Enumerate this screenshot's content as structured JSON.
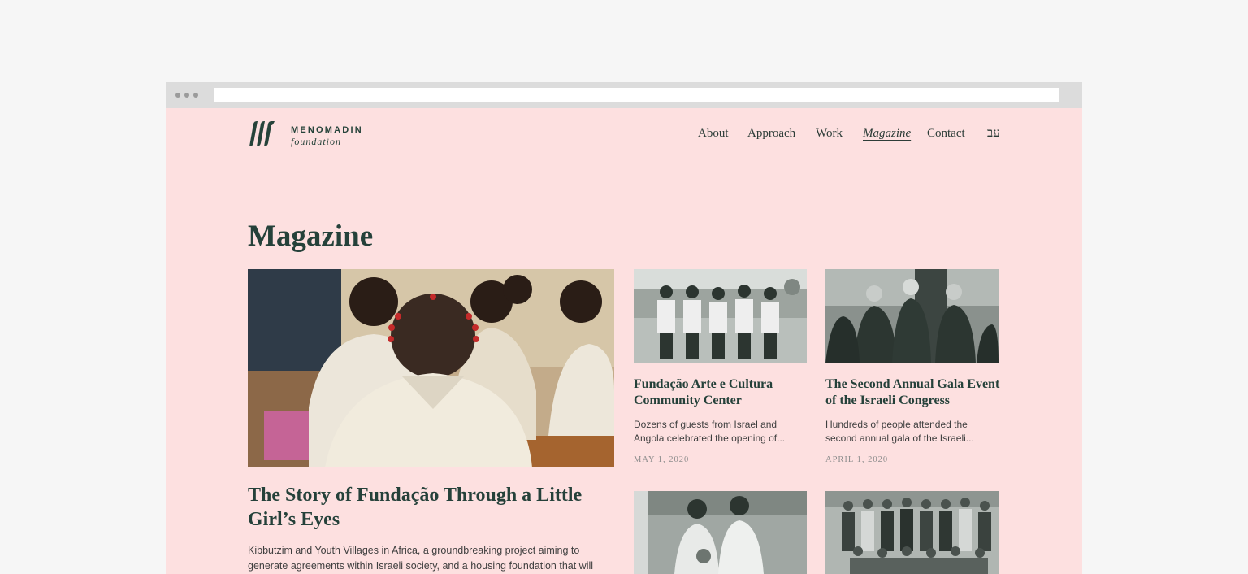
{
  "logo": {
    "name": "MENOMADIN",
    "sub": "foundation"
  },
  "nav": {
    "items": [
      {
        "label": "About"
      },
      {
        "label": "Approach"
      },
      {
        "label": "Work"
      },
      {
        "label": "Magazine"
      },
      {
        "label": "Contact"
      },
      {
        "label": "עב"
      }
    ],
    "active": "Magazine"
  },
  "page": {
    "title": "Magazine"
  },
  "feature": {
    "title": "The Story of Fundação Through a Little Girl’s Eyes",
    "excerpt": "Kibbutzim and Youth Villages in Africa, a groundbreaking project aiming to generate agreements within Israeli society, and a housing foundation that will"
  },
  "articles": [
    {
      "title": "Fundação Arte e Cultura Community Center",
      "excerpt": "Dozens of guests from Israel and Angola celebrated the opening of...",
      "date": "MAY 1, 2020"
    },
    {
      "title": "The Second Annual Gala Event of the Israeli Congress",
      "excerpt": "Hundreds of people attended the second annual gala of the Israeli...",
      "date": "APRIL 1, 2020"
    }
  ],
  "colors": {
    "background": "#f6f6f6",
    "page": "#fde0e0",
    "brand_green": "#25413a",
    "browser_bar": "#dcdcdc"
  }
}
